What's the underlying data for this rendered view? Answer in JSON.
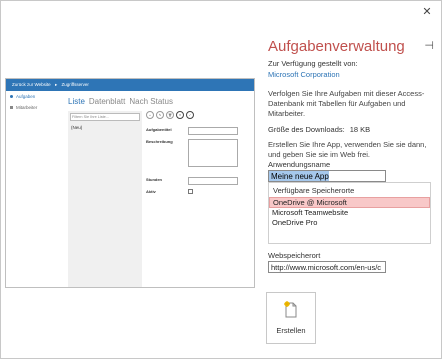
{
  "window": {
    "close_glyph": "✕",
    "pin_glyph": "⊣"
  },
  "preview": {
    "topbar": [
      "Zurück zur Website",
      "▸",
      "Zugriffsserver"
    ],
    "nav": [
      {
        "label": "Aufgaben",
        "active": true
      },
      {
        "label": "Mitarbeiter",
        "active": false
      }
    ],
    "tabs": [
      "Liste",
      "Datenblatt",
      "Nach Status"
    ],
    "search_placeholder": "Filtern Sie Ihre Liste...",
    "list_item": "(Neu)",
    "toolbar_circles": [
      "+",
      "✎",
      "🗑",
      "✕",
      "✓"
    ],
    "fields": [
      "Aufgabentitel",
      "Beschreibung",
      "Stunden",
      "Aktiv"
    ]
  },
  "app": {
    "title": "Aufgabenverwaltung",
    "provider_label": "Zur Verfügung gestellt von:",
    "provider": "Microsoft Corporation",
    "description": "Verfolgen Sie Ihre Aufgaben mit dieser Access-Datenbank mit Tabellen für Aufgaben und Mitarbeiter.",
    "download_label": "Größe des Downloads:",
    "download_size": "18 KB",
    "create_note": "Erstellen Sie Ihre App, verwenden Sie sie dann, und geben Sie sie im Web frei.",
    "name_label": "Anwendungsname",
    "name_value": "Meine neue App",
    "locations_label": "Verfügbare Speicherorte",
    "locations": [
      "OneDrive @ Microsoft",
      "Microsoft Teamwebsite",
      "OneDrive Pro"
    ],
    "selected_location": "OneDrive @ Microsoft",
    "web_label": "Webspeicherort",
    "web_value": "http://www.microsoft.com/en-us/c",
    "create_label": "Erstellen"
  },
  "colors": {
    "accent": "#c0504d",
    "link": "#2e75b6",
    "selection": "#f8c8c8"
  }
}
